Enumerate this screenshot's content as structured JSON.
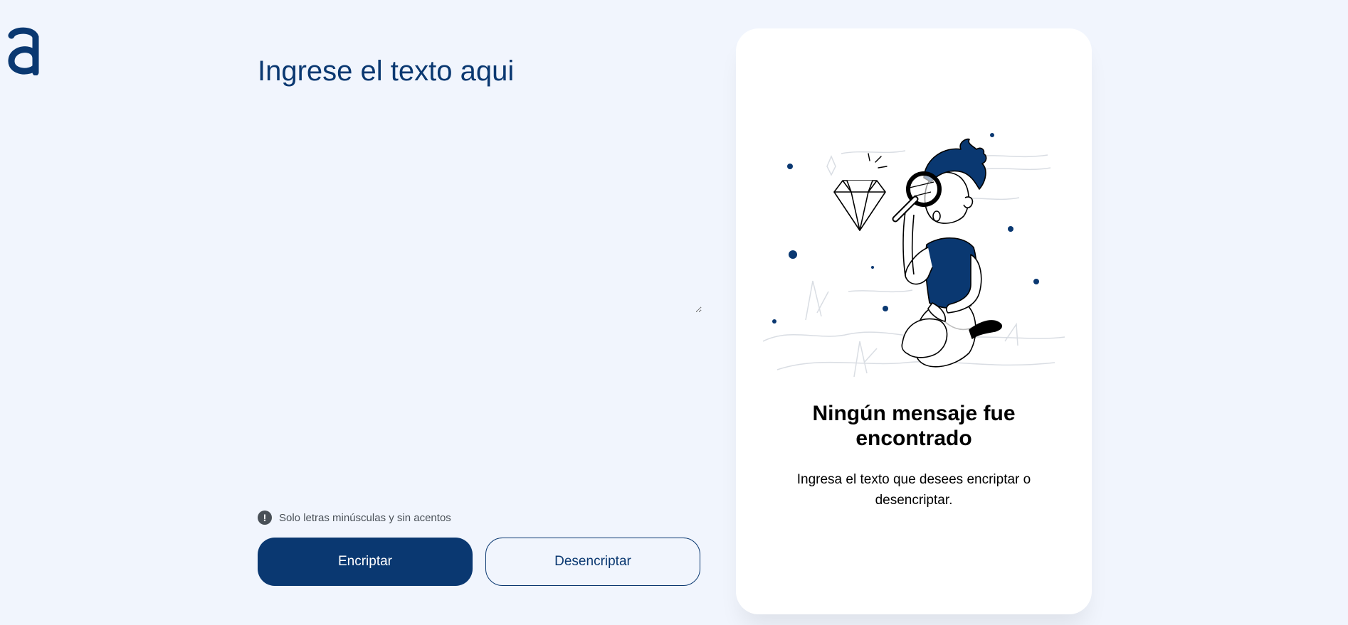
{
  "app": {
    "logo_letter": "a",
    "logo_icon": "alura-logo",
    "accent_color": "#0a3871",
    "background_color": "#f1f5fd"
  },
  "editor": {
    "placeholder": "Ingrese el texto aqui",
    "value": "",
    "hint_icon": "exclamation-circle-icon",
    "hint_text": "Solo letras minúsculas y sin acentos"
  },
  "actions": {
    "encrypt_label": "Encriptar",
    "decrypt_label": "Desencriptar"
  },
  "result": {
    "illustration_icon": "person-with-magnifier-and-diamond-illustration",
    "title": "Ningún mensaje fue encontrado",
    "message": "Ingresa el texto que desees encriptar o desencriptar."
  }
}
